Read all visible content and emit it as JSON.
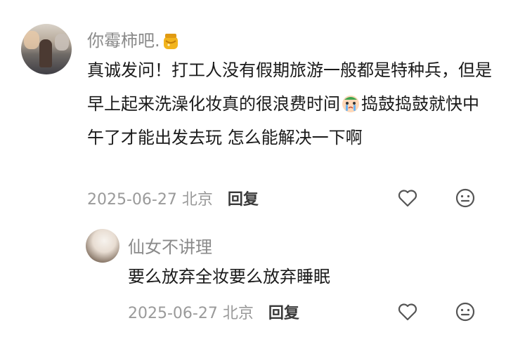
{
  "comments": [
    {
      "username": "你霉柿吧.",
      "username_badge_icon": "honey-jar-icon",
      "text_before_emoji": "真诚发问！打工人没有假期旅游一般都是特种兵，但是早上起来洗澡化妆真的很浪费时间",
      "emoji": "crying-face-icon",
      "text_after_emoji": "捣鼓捣鼓就快中午了才能出发去玩  怎么能解决一下啊",
      "date": "2025-06-27",
      "location": "北京",
      "reply_label": "回复"
    },
    {
      "username": "仙女不讲理",
      "text": "要么放弃全妆要么放弃睡眠",
      "date": "2025-06-27",
      "location": "北京",
      "reply_label": "回复"
    }
  ],
  "colors": {
    "username": "#8a8a8a",
    "meta": "#9a9a9a",
    "body_text": "#1a1a1a"
  }
}
